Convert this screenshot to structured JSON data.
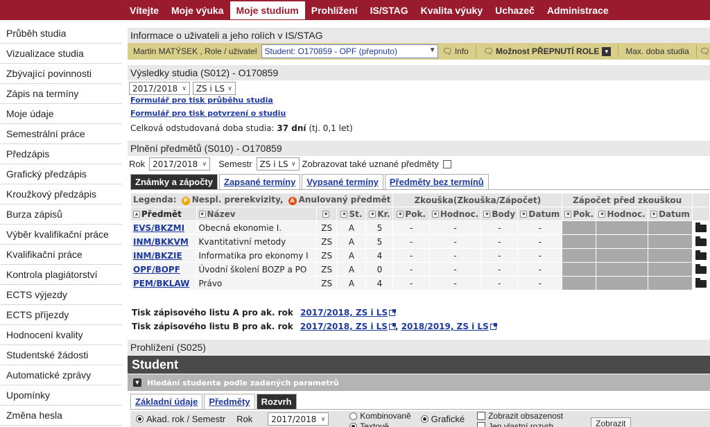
{
  "nav": {
    "items": [
      "Vítejte",
      "Moje výuka",
      "Moje studium",
      "Prohlížení",
      "IS/STAG",
      "Kvalita výuky",
      "Uchazeč",
      "Administrace"
    ],
    "active_index": 2
  },
  "sidebar": {
    "items": [
      "Průběh studia",
      "Vizualizace studia",
      "Zbývající povinnosti",
      "Zápis na termíny",
      "Moje údaje",
      "Semestrální práce",
      "Předzápis",
      "Grafický předzápis",
      "Kroužkový předzápis",
      "Burza zápisů",
      "Výběr kvalifikační práce",
      "Kvalifikační práce",
      "Kontrola plagiátorství",
      "ECTS výjezdy",
      "ECTS příjezdy",
      "Hodnocení kvality",
      "Studentské žádosti",
      "Automatické zprávy",
      "Upomínky",
      "Změna hesla"
    ],
    "active_index": 0
  },
  "user_info": {
    "heading": "Informace o uživateli a jeho rolích v IS/STAG",
    "user_role": "Martin MATÝSEK , Role / uživatel",
    "role_select": "Student: O170859 - OPF (přepnuto)",
    "info_button": "Info",
    "switch_role_button": "Možnost PŘEPNUTÍ ROLE",
    "max_duration_button": "Max. doba studia"
  },
  "results": {
    "heading": "Výsledky studia (S012) - O170859",
    "year_select": "2017/2018",
    "semester_select": "ZS i LS",
    "link_progress": "Formulář pro tisk průběhu studia",
    "link_confirmation": "Formulář pro tisk potvrzení o studiu",
    "duration_label": "Celková odstudovaná doba studia:",
    "duration_value": "37 dní",
    "duration_note": "(tj. 0,1 let)"
  },
  "subjects": {
    "heading": "Plnění předmětů (S010) - O170859",
    "year_label": "Rok",
    "year_select": "2017/2018",
    "semester_label": "Semestr",
    "semester_select": "ZS i LS",
    "show_recognized_label": "Zobrazovat také uznané předměty",
    "show_recognized_checked": false,
    "tabs": [
      "Známky a zápočty",
      "Zapsané termíny",
      "Vypsané termíny",
      "Předměty bez termínů"
    ],
    "active_tab": 0
  },
  "grades_table": {
    "legend_label": "Legenda:",
    "legend_p_letter": "P",
    "legend_p": "Nespl. prerekvizity,",
    "legend_a_letter": "A",
    "legend_a": "Anulovaný předmět",
    "group_exam": "Zkouška(Zkouška/Zápočet)",
    "group_credit": "Zápočet před zkouškou",
    "columns": [
      "Předmět",
      "Název",
      "St.",
      "Kr.",
      "Pok.",
      "Hodnoc.",
      "Body",
      "Datum",
      "Pok.",
      "Hodnoc.",
      "Datum"
    ],
    "rows": [
      {
        "code": "EVS/BKZMI",
        "name": "Obecná ekonomie I.",
        "sem": "ZS",
        "status": "A",
        "credits": "5",
        "attempts": "-",
        "grade": "-",
        "points": "-",
        "date": "-"
      },
      {
        "code": "INM/BKKVM",
        "name": "Kvantitativní metody",
        "sem": "ZS",
        "status": "A",
        "credits": "5",
        "attempts": "-",
        "grade": "-",
        "points": "-",
        "date": "-"
      },
      {
        "code": "INM/BKZIE",
        "name": "Informatika pro ekonomy I",
        "sem": "ZS",
        "status": "A",
        "credits": "4",
        "attempts": "-",
        "grade": "-",
        "points": "-",
        "date": "-"
      },
      {
        "code": "OPF/BOPF",
        "name": "Úvodní školení BOZP a PO",
        "sem": "ZS",
        "status": "A",
        "credits": "0",
        "attempts": "-",
        "grade": "-",
        "points": "-",
        "date": "-"
      },
      {
        "code": "PEM/BKLAW",
        "name": "Právo",
        "sem": "ZS",
        "status": "A",
        "credits": "4",
        "attempts": "-",
        "grade": "-",
        "points": "-",
        "date": "-"
      }
    ]
  },
  "print": {
    "list_a_label": "Tisk zápisového listu A pro ak. rok",
    "list_a_link": "2017/2018, ZS i LS",
    "list_b_label": "Tisk zápisového listu B pro ak. rok",
    "list_b_link1": "2017/2018, ZS i LS",
    "list_b_sep": ",",
    "list_b_link2": "2018/2019, ZS i LS"
  },
  "browse": {
    "heading": "Prohlížení (S025)",
    "student_title": "Student",
    "search_label": "Hledání studenta podle zadaných parametrů",
    "tabs": [
      "Základní údaje",
      "Předměty",
      "Rozvrh"
    ],
    "active_tab": 2,
    "radio_year_semester": "Akad. rok / Semestr",
    "year_label": "Rok",
    "year_select": "2017/2018",
    "radio_combined": "Kombinovaně",
    "radio_text": "Textově",
    "radio_graphic": "Grafické",
    "show_occupancy": "Zobrazit obsazenost",
    "second_checkbox": "Jen vlastní rozvrh",
    "show_button": "Zobrazit"
  },
  "colors": {
    "nav_bg": "#9b1b2e",
    "user_bar": "#d9cf8a",
    "link": "#1d3a9c",
    "active_tab": "#2f2f2f",
    "student_bar": "#4a4a4a"
  },
  "icons": [
    "chat-icon",
    "dropdown-icon",
    "folder-open-icon",
    "external-link-icon",
    "sort-icon",
    "collapse-icon"
  ]
}
